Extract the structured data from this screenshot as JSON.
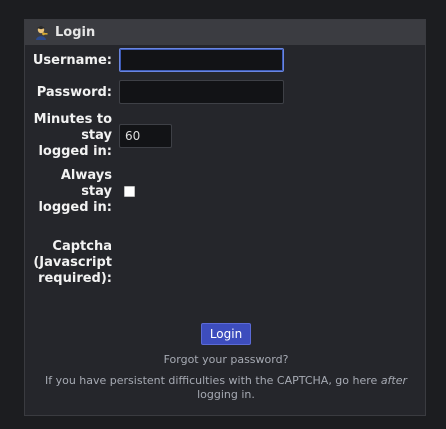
{
  "panel": {
    "title": "Login",
    "icon": "user-key-icon"
  },
  "form": {
    "username_label": "Username:",
    "username_value": "",
    "password_label": "Password:",
    "password_value": "",
    "minutes_label_lines": [
      "Minutes to",
      "stay",
      "logged in:"
    ],
    "minutes_value": "60",
    "always_label_lines": [
      "Always",
      "stay",
      "logged in:"
    ],
    "always_checked": false,
    "captcha_label_lines": [
      "Captcha",
      "(Javascript",
      "required):"
    ]
  },
  "actions": {
    "login_label": "Login",
    "forgot_link": "Forgot your password?"
  },
  "note": {
    "text_before": "If you have persistent difficulties with the CAPTCHA, go here",
    "emphasis": "after",
    "text_after": "logging in."
  },
  "colors": {
    "background": "#1c1d20",
    "panel": "#25262b",
    "header": "#3b3c41",
    "accent": "#3d4dbd"
  }
}
